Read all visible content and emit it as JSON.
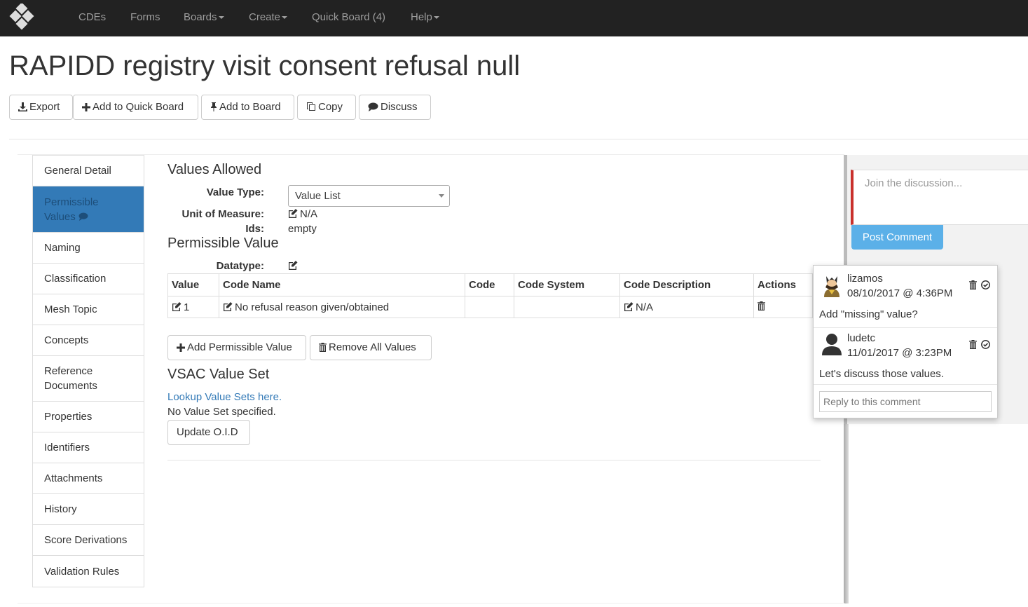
{
  "nav": {
    "items": [
      {
        "label": "CDEs",
        "dropdown": false
      },
      {
        "label": "Forms",
        "dropdown": false
      },
      {
        "label": "Boards",
        "dropdown": true
      },
      {
        "label": "Create",
        "dropdown": true
      },
      {
        "label": "Quick Board (4)",
        "dropdown": false
      },
      {
        "label": "Help",
        "dropdown": true
      }
    ]
  },
  "page": {
    "title": "RAPIDD registry visit consent refusal null"
  },
  "toolbar": {
    "export": "Export",
    "add_quick_board": "Add to Quick Board",
    "add_board": "Add to Board",
    "copy": "Copy",
    "discuss": "Discuss"
  },
  "sidebar": {
    "items": [
      {
        "label": "General Detail"
      },
      {
        "label": "Permissible Values",
        "active": true
      },
      {
        "label": "Naming"
      },
      {
        "label": "Classification"
      },
      {
        "label": "Mesh Topic"
      },
      {
        "label": "Concepts"
      },
      {
        "label": "Reference Documents"
      },
      {
        "label": "Properties"
      },
      {
        "label": "Identifiers"
      },
      {
        "label": "Attachments"
      },
      {
        "label": "History"
      },
      {
        "label": "Score Derivations"
      },
      {
        "label": "Validation Rules"
      }
    ]
  },
  "values_allowed": {
    "heading": "Values Allowed",
    "value_type_label": "Value Type:",
    "value_type": "Value List",
    "uom_label": "Unit of Measure:",
    "uom_value": "N/A",
    "ids_label": "Ids:",
    "ids_value": "empty"
  },
  "permissible_value": {
    "heading": "Permissible Value",
    "datatype_label": "Datatype:",
    "table": {
      "headers": [
        "Value",
        "Code Name",
        "Code",
        "Code System",
        "Code Description",
        "Actions"
      ],
      "rows": [
        {
          "value": "1",
          "code_name": "No refusal reason given/obtained",
          "code": "",
          "code_system": "",
          "code_description": "N/A"
        }
      ]
    },
    "add_button": "Add Permissible Value",
    "remove_button": "Remove All Values"
  },
  "vsac": {
    "heading": "VSAC Value Set",
    "lookup_link": "Lookup Value Sets here.",
    "status": "No Value Set specified.",
    "update_button": "Update O.I.D"
  },
  "discussion": {
    "placeholder": "Join the discussion...",
    "post_button": "Post Comment",
    "comments": [
      {
        "user": "lizamos",
        "date": "08/10/2017 @ 4:36PM",
        "text": "Add \"missing\" value?"
      },
      {
        "user": "ludetc",
        "date": "11/01/2017 @ 3:23PM",
        "text": "Let's discuss those values."
      }
    ],
    "reply_placeholder": "Reply to this comment"
  },
  "colors": {
    "navbar": "#222222",
    "active_nav": "#337ab7",
    "link": "#337ab7",
    "post_button": "#5bb0e8",
    "discussion_accent": "#c9302c"
  }
}
